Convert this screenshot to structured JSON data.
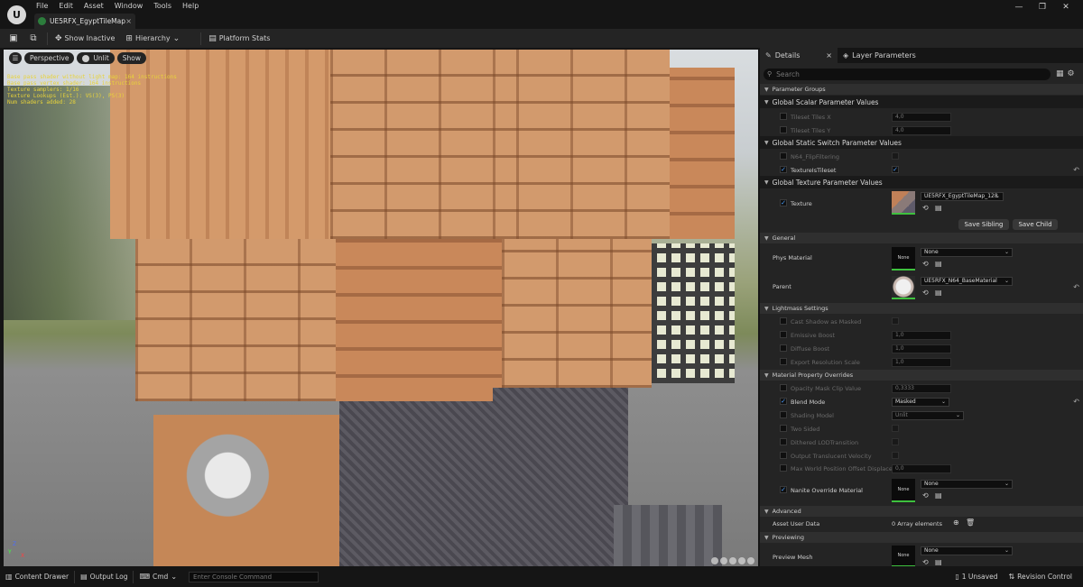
{
  "menu": [
    "File",
    "Edit",
    "Asset",
    "Window",
    "Tools",
    "Help"
  ],
  "document_tab": {
    "label": "UE5RFX_EgyptTileMap..."
  },
  "toolbar": {
    "show_inactive": "Show Inactive",
    "hierarchy": "Hierarchy",
    "platform_stats": "Platform Stats"
  },
  "viewport": {
    "perspective": "Perspective",
    "unlit": "Unlit",
    "show": "Show",
    "stats": [
      "Base pass shader without light map: 164 instructions",
      "Base pass vertex shader: 164 instructions",
      "Texture samplers: 1/16",
      "Texture Lookups (Est.): VS(3), PS(3)",
      "Num shaders added: 28"
    ]
  },
  "details": {
    "tab_details": "Details",
    "tab_layer_params": "Layer Parameters",
    "search_placeholder": "Search",
    "parameter_groups": "Parameter Groups",
    "global_scalar": "Global Scalar Parameter Values",
    "tileset_x": {
      "name": "Tileset Tiles X",
      "value": "4,0"
    },
    "tileset_y": {
      "name": "Tileset Tiles Y",
      "value": "4,0"
    },
    "global_static_switch": "Global Static Switch Parameter Values",
    "n64_flip": "N64_FlipFiltering",
    "texture_is_tileset": "TextureIsTileset",
    "global_texture": "Global Texture Parameter Values",
    "texture_label": "Texture",
    "texture_value": "UE5RFX_EgyptTileMap_128",
    "save_sibling": "Save Sibling",
    "save_child": "Save Child",
    "general": "General",
    "phys_material": "Phys Material",
    "phys_material_value": "None",
    "none_label": "None",
    "parent": "Parent",
    "parent_value": "UE5RFX_N64_BaseMaterial",
    "lightmass": "Lightmass Settings",
    "cast_shadow": "Cast Shadow as Masked",
    "emissive_boost": {
      "name": "Emissive Boost",
      "value": "1,0"
    },
    "diffuse_boost": {
      "name": "Diffuse Boost",
      "value": "1,0"
    },
    "export_res": {
      "name": "Export Resolution Scale",
      "value": "1,0"
    },
    "mpo": "Material Property Overrides",
    "opacity_mask": {
      "name": "Opacity Mask Clip Value",
      "value": "0,3333"
    },
    "blend_mode": {
      "name": "Blend Mode",
      "value": "Masked"
    },
    "shading_model": {
      "name": "Shading Model",
      "value": "Unlit"
    },
    "two_sided": "Two Sided",
    "dithered_lod": "Dithered LODTransition",
    "output_translucent": "Output Translucent Velocity",
    "max_wpo": {
      "name": "Max World Position Offset Displacem...",
      "value": "0,0"
    },
    "nanite_override": "Nanite Override Material",
    "nanite_value": "None",
    "advanced": "Advanced",
    "asset_user_data": "Asset User Data",
    "array_elements": "0 Array elements",
    "previewing": "Previewing",
    "preview_mesh": "Preview Mesh",
    "preview_mesh_value": "None"
  },
  "statusbar": {
    "content_drawer": "Content Drawer",
    "output_log": "Output Log",
    "cmd": "Cmd",
    "console_placeholder": "Enter Console Command",
    "unsaved": "1 Unsaved",
    "revision_control": "Revision Control"
  },
  "colors": {
    "accent_green": "#3ec13e",
    "checkbox_blue": "#4a9eff",
    "panel_bg": "#242424",
    "stat_yellow": "#e8d33a"
  }
}
